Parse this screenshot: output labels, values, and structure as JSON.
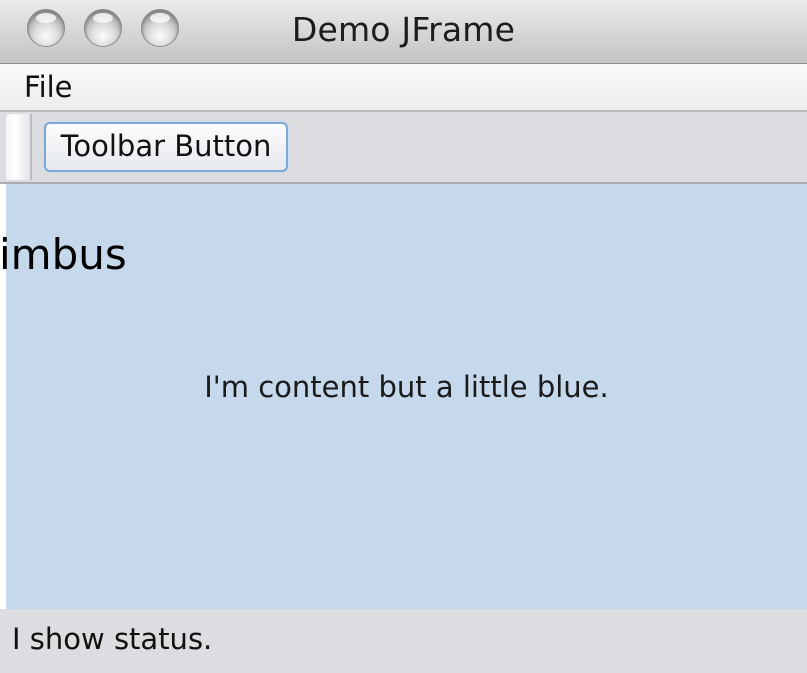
{
  "window": {
    "title": "Demo JFrame"
  },
  "menubar": {
    "items": [
      {
        "label": "File"
      }
    ]
  },
  "toolbar": {
    "button_label": "Toolbar Button"
  },
  "content": {
    "side_label": "imbus",
    "message": "I'm content but a little blue.",
    "background_color": "#c5d8ec"
  },
  "statusbar": {
    "text": "I show status."
  }
}
